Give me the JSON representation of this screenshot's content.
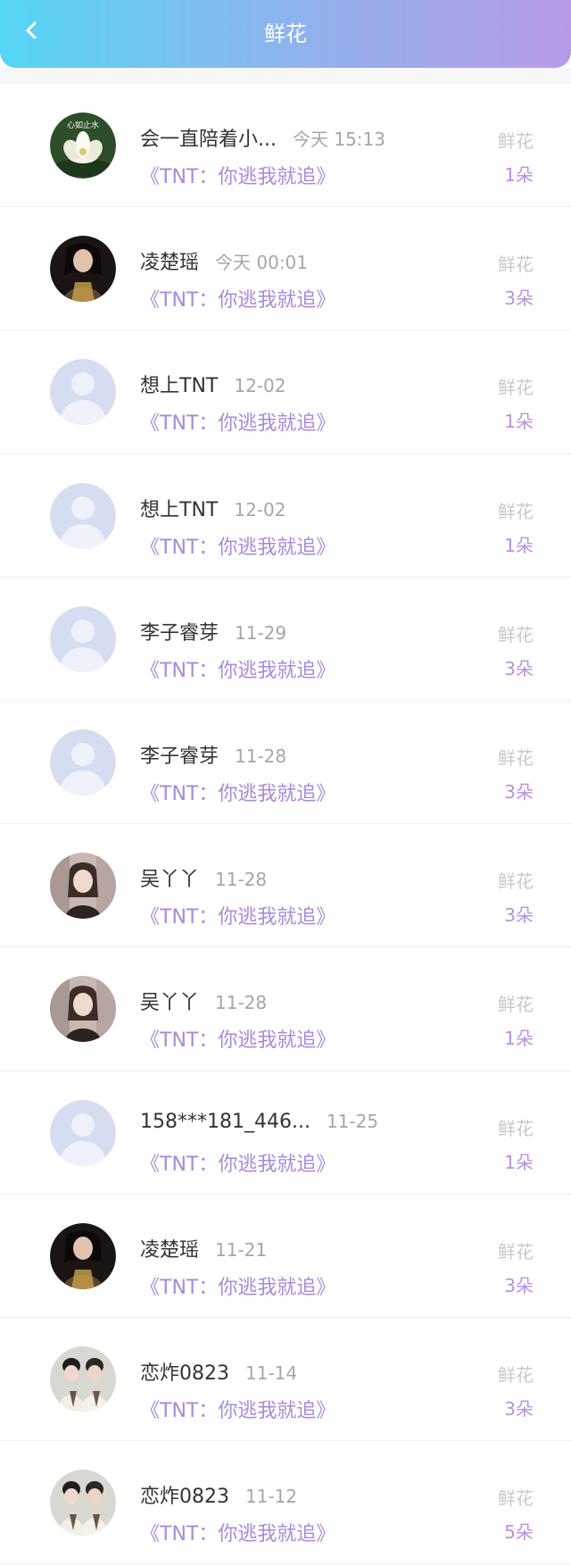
{
  "header": {
    "title": "鲜花",
    "back_icon": "chevron-left-icon",
    "gradient": [
      "#55d6f4",
      "#b79ae9"
    ]
  },
  "records": [
    {
      "name": "会一直陪着小...",
      "time": "今天 15:13",
      "book": "《TNT：你逃我就追》",
      "gift": "鲜花",
      "count": "1朵",
      "avatar": "lotus-avatar",
      "avatar_text": "心如止水"
    },
    {
      "name": "凌楚瑶",
      "time": "今天 00:01",
      "book": "《TNT：你逃我就追》",
      "gift": "鲜花",
      "count": "3朵",
      "avatar": "girl-dark-avatar"
    },
    {
      "name": "想上TNT",
      "time": "12-02",
      "book": "《TNT：你逃我就追》",
      "gift": "鲜花",
      "count": "1朵",
      "avatar": "default-avatar"
    },
    {
      "name": "想上TNT",
      "time": "12-02",
      "book": "《TNT：你逃我就追》",
      "gift": "鲜花",
      "count": "1朵",
      "avatar": "default-avatar"
    },
    {
      "name": "李子睿芽",
      "time": "11-29",
      "book": "《TNT：你逃我就追》",
      "gift": "鲜花",
      "count": "3朵",
      "avatar": "default-avatar"
    },
    {
      "name": "李子睿芽",
      "time": "11-28",
      "book": "《TNT：你逃我就追》",
      "gift": "鲜花",
      "count": "3朵",
      "avatar": "default-avatar"
    },
    {
      "name": "吴丫丫",
      "time": "11-28",
      "book": "《TNT：你逃我就追》",
      "gift": "鲜花",
      "count": "3朵",
      "avatar": "girl-light-avatar"
    },
    {
      "name": "吴丫丫",
      "time": "11-28",
      "book": "《TNT：你逃我就追》",
      "gift": "鲜花",
      "count": "1朵",
      "avatar": "girl-light-avatar"
    },
    {
      "name": "158***181_446...",
      "time": "11-25",
      "book": "《TNT：你逃我就追》",
      "gift": "鲜花",
      "count": "1朵",
      "avatar": "default-avatar"
    },
    {
      "name": "凌楚瑶",
      "time": "11-21",
      "book": "《TNT：你逃我就追》",
      "gift": "鲜花",
      "count": "3朵",
      "avatar": "girl-dark-avatar"
    },
    {
      "name": "恋炸0823",
      "time": "11-14",
      "book": "《TNT：你逃我就追》",
      "gift": "鲜花",
      "count": "3朵",
      "avatar": "boy-pair-avatar"
    },
    {
      "name": "恋炸0823",
      "time": "11-12",
      "book": "《TNT：你逃我就追》",
      "gift": "鲜花",
      "count": "5朵",
      "avatar": "boy-pair-avatar"
    }
  ]
}
